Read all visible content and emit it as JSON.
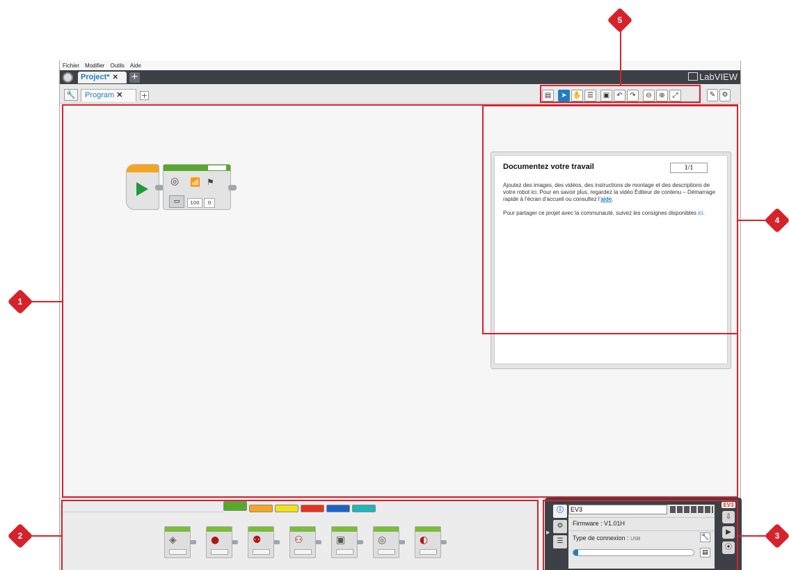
{
  "menu": {
    "items": [
      "Fichier",
      "Modifier",
      "Outils",
      "Aide"
    ]
  },
  "titlebar": {
    "project_tab": "Project*",
    "project_close": "✕",
    "add": "+",
    "brand": "LabVIEW"
  },
  "tabrow": {
    "program_tab": "Program",
    "program_close": "✕",
    "add": "+"
  },
  "program": {
    "motor_power": "100",
    "motor_rotations": "0"
  },
  "content_editor": {
    "title": "Documentez votre travail",
    "page": "1/1",
    "para1": "Ajoutez des images, des vidéos, des instructions de montage et des descriptions de votre robot ici. Pour en savoir plus, regardez la vidéo Éditeur de contenu – Démarrage rapide à l'écran d'accueil ou consultez l'",
    "aide_link": "aide",
    "para1_end": ".",
    "para2": "Pour partager ce projet avec la communauté, suivez les consignes disponibles ",
    "ici_link": "ici",
    "para2_end": "."
  },
  "palette": {
    "tab_colors": [
      "#58a82d",
      "#f4a623",
      "#f2e21c",
      "#e8321e",
      "#1a64c8",
      "#20b5b8"
    ]
  },
  "hardware": {
    "brick_name": "EV3",
    "firmware": "Firmware : V1.01H",
    "connection_label": "Type de connexion :",
    "connection_value": "USB",
    "memory_fraction": 0.04,
    "badge": "EV3"
  },
  "callouts": {
    "c1": "1",
    "c2": "2",
    "c3": "3",
    "c4": "4",
    "c5": "5"
  },
  "colors": {
    "accent": "#1f7ec2",
    "callout": "#d6222b",
    "titlebar": "#3e4047"
  }
}
